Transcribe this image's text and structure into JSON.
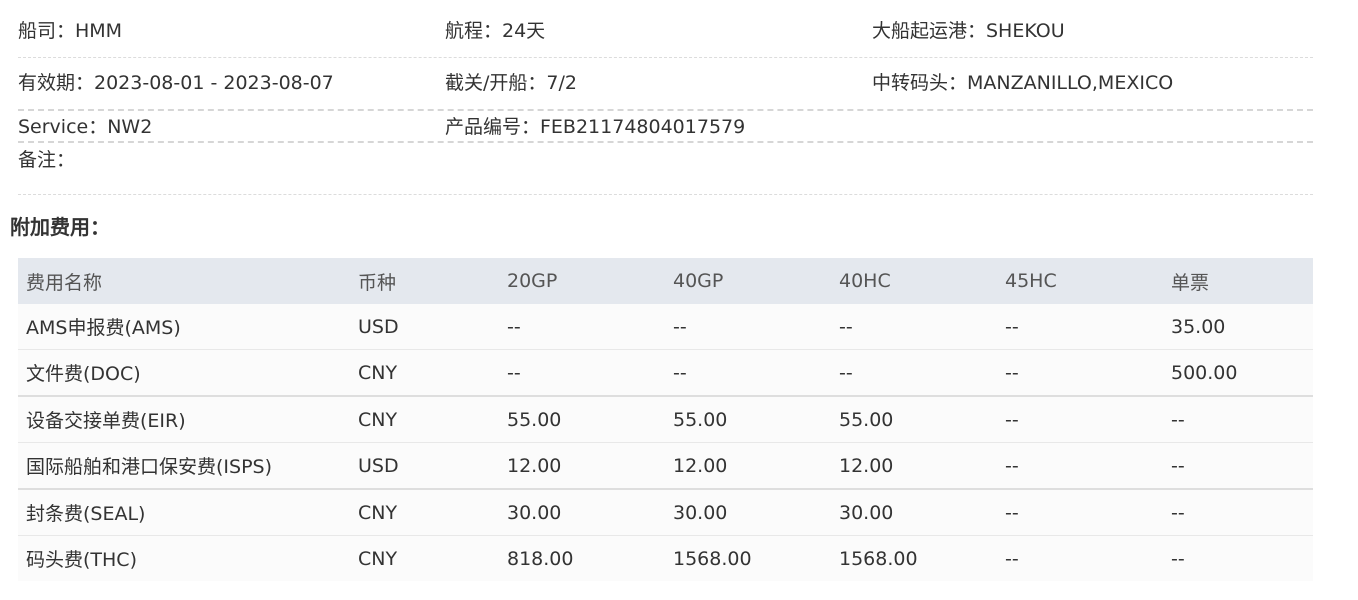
{
  "info": {
    "carrier": "船司：HMM",
    "voyage": "航程：24天",
    "origin_port": "大船起运港：SHEKOU",
    "validity": "有效期：2023-08-01 - 2023-08-07",
    "cutoff": "截关/开船：7/2",
    "transit_port": "中转码头：MANZANILLO,MEXICO",
    "service": "Service：NW2",
    "product_no": "产品编号：FEB21174804017579",
    "remark": "备注："
  },
  "fees": {
    "title": "附加费用：",
    "headers": [
      "费用名称",
      "币种",
      "20GP",
      "40GP",
      "40HC",
      "45HC",
      "单票"
    ],
    "rows": [
      [
        "AMS申报费(AMS)",
        "USD",
        "--",
        "--",
        "--",
        "--",
        "35.00"
      ],
      [
        "文件费(DOC)",
        "CNY",
        "--",
        "--",
        "--",
        "--",
        "500.00"
      ],
      [
        "设备交接单费(EIR)",
        "CNY",
        "55.00",
        "55.00",
        "55.00",
        "--",
        "--"
      ],
      [
        "国际船舶和港口保安费(ISPS)",
        "USD",
        "12.00",
        "12.00",
        "12.00",
        "--",
        "--"
      ],
      [
        "封条费(SEAL)",
        "CNY",
        "30.00",
        "30.00",
        "30.00",
        "--",
        "--"
      ],
      [
        "码头费(THC)",
        "CNY",
        "818.00",
        "1568.00",
        "1568.00",
        "--",
        "--"
      ]
    ]
  }
}
